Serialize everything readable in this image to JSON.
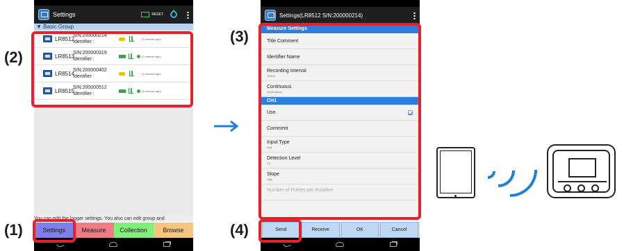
{
  "callouts": [
    "(1)",
    "(2)",
    "(3)",
    "(4)"
  ],
  "phone1": {
    "title": "Settings",
    "reset_label": "RESET",
    "group_header": "▼ Basic Group",
    "devices": [
      {
        "model": "LR8512",
        "serial": "S/N:200000214",
        "identifier": "Identifier :",
        "status": "(5 minutes ago)",
        "badge": "key"
      },
      {
        "model": "LR8513",
        "serial": "S/N:200000319",
        "identifier": "Identifier :",
        "status": "(2 minutes ago)",
        "badge": "battery"
      },
      {
        "model": "LR8514",
        "serial": "S/N:200000402",
        "identifier": "Identifier :",
        "status": "(4 minutes ago)",
        "badge": "key"
      },
      {
        "model": "LR8515",
        "serial": "S/N:200000512",
        "identifier": "Identifier :",
        "status": "(3 minutes ago)",
        "badge": "battery"
      }
    ],
    "hint": "You can edit the logger settings. You also can edit group and",
    "tabs": [
      {
        "label": "Settings",
        "color": "#7f7ff0"
      },
      {
        "label": "Measure",
        "color": "#f07c86"
      },
      {
        "label": "Collection",
        "color": "#7ff07a"
      },
      {
        "label": "Browse",
        "color": "#f6c47c"
      }
    ]
  },
  "phone2": {
    "title": "Settings(LR8512 S/N:200000214)",
    "section1": "Measure Settings",
    "items1": [
      {
        "label": "Title Comment",
        "sub": ""
      },
      {
        "label": "Identifier Name",
        "sub": ""
      },
      {
        "label": "Recording Interval",
        "sub": "100ms"
      },
      {
        "label": "Continuous",
        "sub": "On(Endless)"
      }
    ],
    "section2": "CH1",
    "items2": [
      {
        "label": "Use",
        "sub": "",
        "checked": true
      },
      {
        "label": "Comment",
        "sub": ""
      },
      {
        "label": "Input Type",
        "sub": "Add"
      },
      {
        "label": "Detection Level",
        "sub": "1V"
      },
      {
        "label": "Slope",
        "sub": "High"
      },
      {
        "label": "Number of Pulses per Rotation",
        "sub": "1",
        "disabled": true
      }
    ],
    "buttons": [
      "Send",
      "Receive",
      "OK",
      "Cancel"
    ]
  },
  "colors": {
    "highlight": "#e8202a",
    "section": "#2b7fe0",
    "wave": "#1f7fd6"
  },
  "icons": [
    "settings-app-icon",
    "reset-icon",
    "network-icon",
    "menu-icon",
    "logger-device-icon",
    "key-icon",
    "battery-icon",
    "signal-bars-icon",
    "back-icon",
    "home-icon",
    "recent-icon",
    "arrow-right-icon",
    "tablet-icon",
    "wireless-icon",
    "data-logger-icon"
  ]
}
